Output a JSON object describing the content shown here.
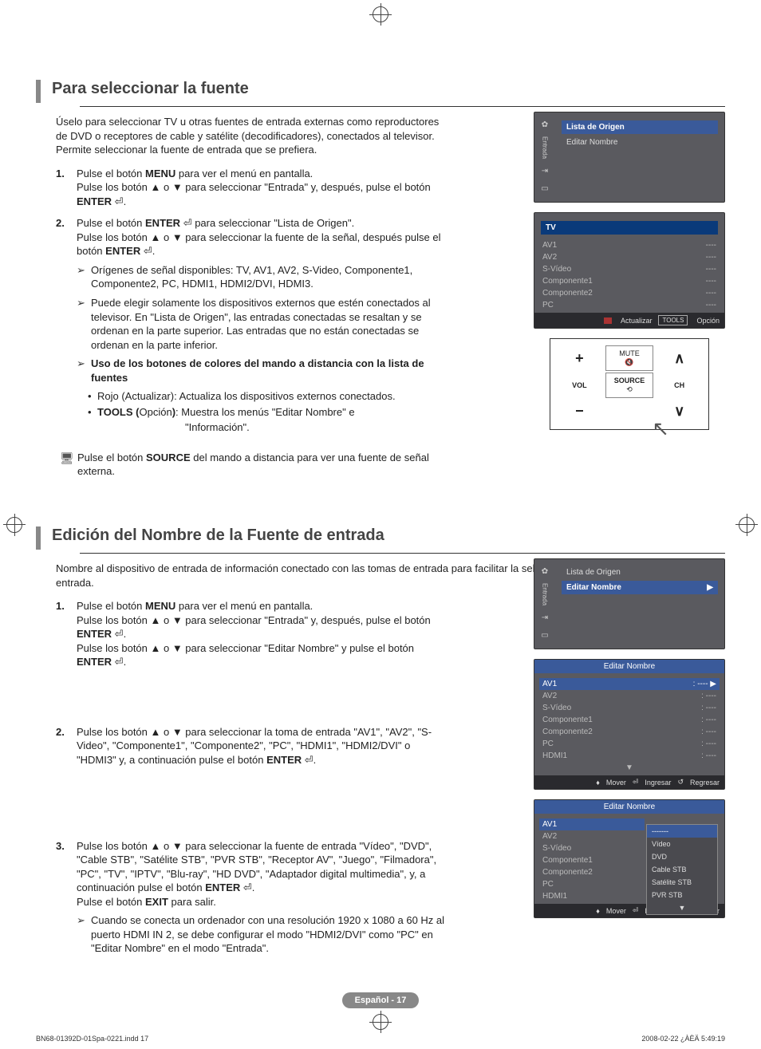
{
  "section1": {
    "title": "Para seleccionar la fuente",
    "intro": "Úselo para seleccionar TV u otras fuentes de entrada externas como reproductores de DVD o receptores de cable y satélite (decodificadores), conectados al televisor. Permite seleccionar la fuente de entrada que se prefiera.",
    "steps": [
      {
        "num": "1.",
        "html": "Pulse el botón <b>MENU</b> para ver el menú en pantalla.<br>Pulse los botón ▲ o ▼ para seleccionar \"Entrada\" y, después, pulse el botón <b>ENTER</b> ⏎."
      },
      {
        "num": "2.",
        "html": "Pulse el botón <b>ENTER</b> ⏎ para seleccionar \"Lista de Origen\".<br>Pulse los botón ▲ o ▼ para seleccionar la fuente de la señal, después pulse el botón <b>ENTER</b> ⏎.",
        "subs": [
          {
            "mark": "➢",
            "text": "Orígenes de señal disponibles: TV, AV1, AV2, S-Video, Componente1, Componente2, PC, HDMI1, HDMI2/DVI, HDMI3."
          },
          {
            "mark": "➢",
            "text": "Puede elegir solamente los dispositivos externos que estén conectados al televisor. En \"Lista de Origen\", las entradas conectadas se resaltan y se ordenan en la parte superior. Las entradas que no están conectadas se ordenan en la parte inferior."
          },
          {
            "mark": "➢",
            "bold": true,
            "text": "Uso de los botones de colores del mando a distancia con la lista de fuentes"
          }
        ],
        "bullets": [
          "Rojo (Actualizar): Actualiza los dispositivos externos conectados.",
          "TOOLS (Opción): Muestra los menús \"Editar Nombre\" e",
          "\"Información\"."
        ]
      }
    ],
    "note": "Pulse el botón <b>SOURCE</b> del mando a distancia para ver una fuente de señal externa."
  },
  "section2": {
    "title": "Edición del Nombre de la Fuente de entrada",
    "intro": "Nombre al dispositivo de entrada de información conectado con las tomas de entrada para facilitar la selección de fuente de entrada.",
    "steps": [
      {
        "num": "1.",
        "html": "Pulse el botón <b>MENU</b> para ver el menú en pantalla.<br>Pulse los botón ▲ o ▼ para seleccionar \"Entrada\" y, después, pulse el botón <b>ENTER</b> ⏎.<br>Pulse los botón ▲ o ▼ para seleccionar \"Editar Nombre\" y pulse el botón <b>ENTER</b> ⏎."
      },
      {
        "num": "2.",
        "html": "Pulse los botón ▲ o ▼ para seleccionar la toma de entrada \"AV1\", \"AV2\", \"S-Video\", \"Componente1\", \"Componente2\", \"PC\", \"HDMI1\", \"HDMI2/DVI\" o \"HDMI3\" y, a continuación pulse el botón <b>ENTER</b> ⏎."
      },
      {
        "num": "3.",
        "html": "Pulse los botón ▲ o ▼ para seleccionar la fuente de entrada \"Vídeo\", \"DVD\", \"Cable STB\", \"Satélite STB\", \"PVR STB\", \"Receptor AV\", \"Juego\", \"Filmadora\", \"PC\", \"TV\", \"IPTV\", \"Blu-ray\", \"HD DVD\", \"Adaptador digital multimedia\", y, a continuación pulse el botón <b>ENTER</b> ⏎.<br>Pulse el botón <b>EXIT</b> para salir.",
        "subs": [
          {
            "mark": "➢",
            "text": "Cuando se conecta un ordenador con una resolución 1920 x 1080 a 60 Hz al puerto HDMI IN 2, se debe configurar el modo \"HDMI2/DVI\" como \"PC\" en \"Editar Nombre\" en el modo \"Entrada\"."
          }
        ]
      }
    ]
  },
  "osd1": {
    "side_label": "Entrada",
    "items": [
      {
        "label": "Lista de Origen",
        "value": "",
        "hl": true
      },
      {
        "label": "Editar Nombre",
        "value": ""
      }
    ]
  },
  "osd2": {
    "title_tv": "TV",
    "rows": [
      {
        "l": "AV1",
        "r": "----"
      },
      {
        "l": "AV2",
        "r": "----"
      },
      {
        "l": "S-Vídeo",
        "r": "----"
      },
      {
        "l": "Componente1",
        "r": "----"
      },
      {
        "l": "Componente2",
        "r": "----"
      },
      {
        "l": "PC",
        "r": "----"
      }
    ],
    "footer_actualizar": "Actualizar",
    "footer_opcion": "Opción",
    "tools": "TOOLS"
  },
  "remote": {
    "mute": "MUTE",
    "vol": "VOL",
    "source": "SOURCE",
    "ch": "CH"
  },
  "osd3": {
    "side_label": "Entrada",
    "items": [
      {
        "label": "Lista de Origen",
        "value": ""
      },
      {
        "label": "Editar Nombre",
        "value": "",
        "hl": true
      }
    ]
  },
  "osd4": {
    "title": "Editar Nombre",
    "rows": [
      {
        "l": "AV1",
        "r": ": ----",
        "sel": true
      },
      {
        "l": "AV2",
        "r": ": ----"
      },
      {
        "l": "S-Vídeo",
        "r": ": ----"
      },
      {
        "l": "Componente1",
        "r": ": ----"
      },
      {
        "l": "Componente2",
        "r": ": ----"
      },
      {
        "l": "PC",
        "r": ": ----"
      },
      {
        "l": "HDMI1",
        "r": ": ----"
      }
    ],
    "down": "▼",
    "mover": "Mover",
    "ingresar": "Ingresar",
    "regresar": "Regresar"
  },
  "osd5": {
    "title": "Editar Nombre",
    "rows": [
      {
        "l": "AV1",
        "sel": true
      },
      {
        "l": "AV2"
      },
      {
        "l": "S-Vídeo"
      },
      {
        "l": "Componente1"
      },
      {
        "l": "Componente2"
      },
      {
        "l": "PC"
      },
      {
        "l": "HDMI1"
      }
    ],
    "dd": [
      {
        "t": "-------",
        "sel": true
      },
      {
        "t": "Vídeo"
      },
      {
        "t": "DVD"
      },
      {
        "t": "Cable STB"
      },
      {
        "t": "Satélite STB"
      },
      {
        "t": "PVR STB"
      }
    ],
    "dd_down": "▼",
    "mover": "Mover",
    "ingresar": "Ingresar",
    "regresar": "Regresar"
  },
  "pagefoot": {
    "badge": "Español - 17",
    "left": "BN68-01392D-01Spa-0221.indd   17",
    "right": "2008-02-22   ¿ÀÈÄ 5:49:19"
  }
}
